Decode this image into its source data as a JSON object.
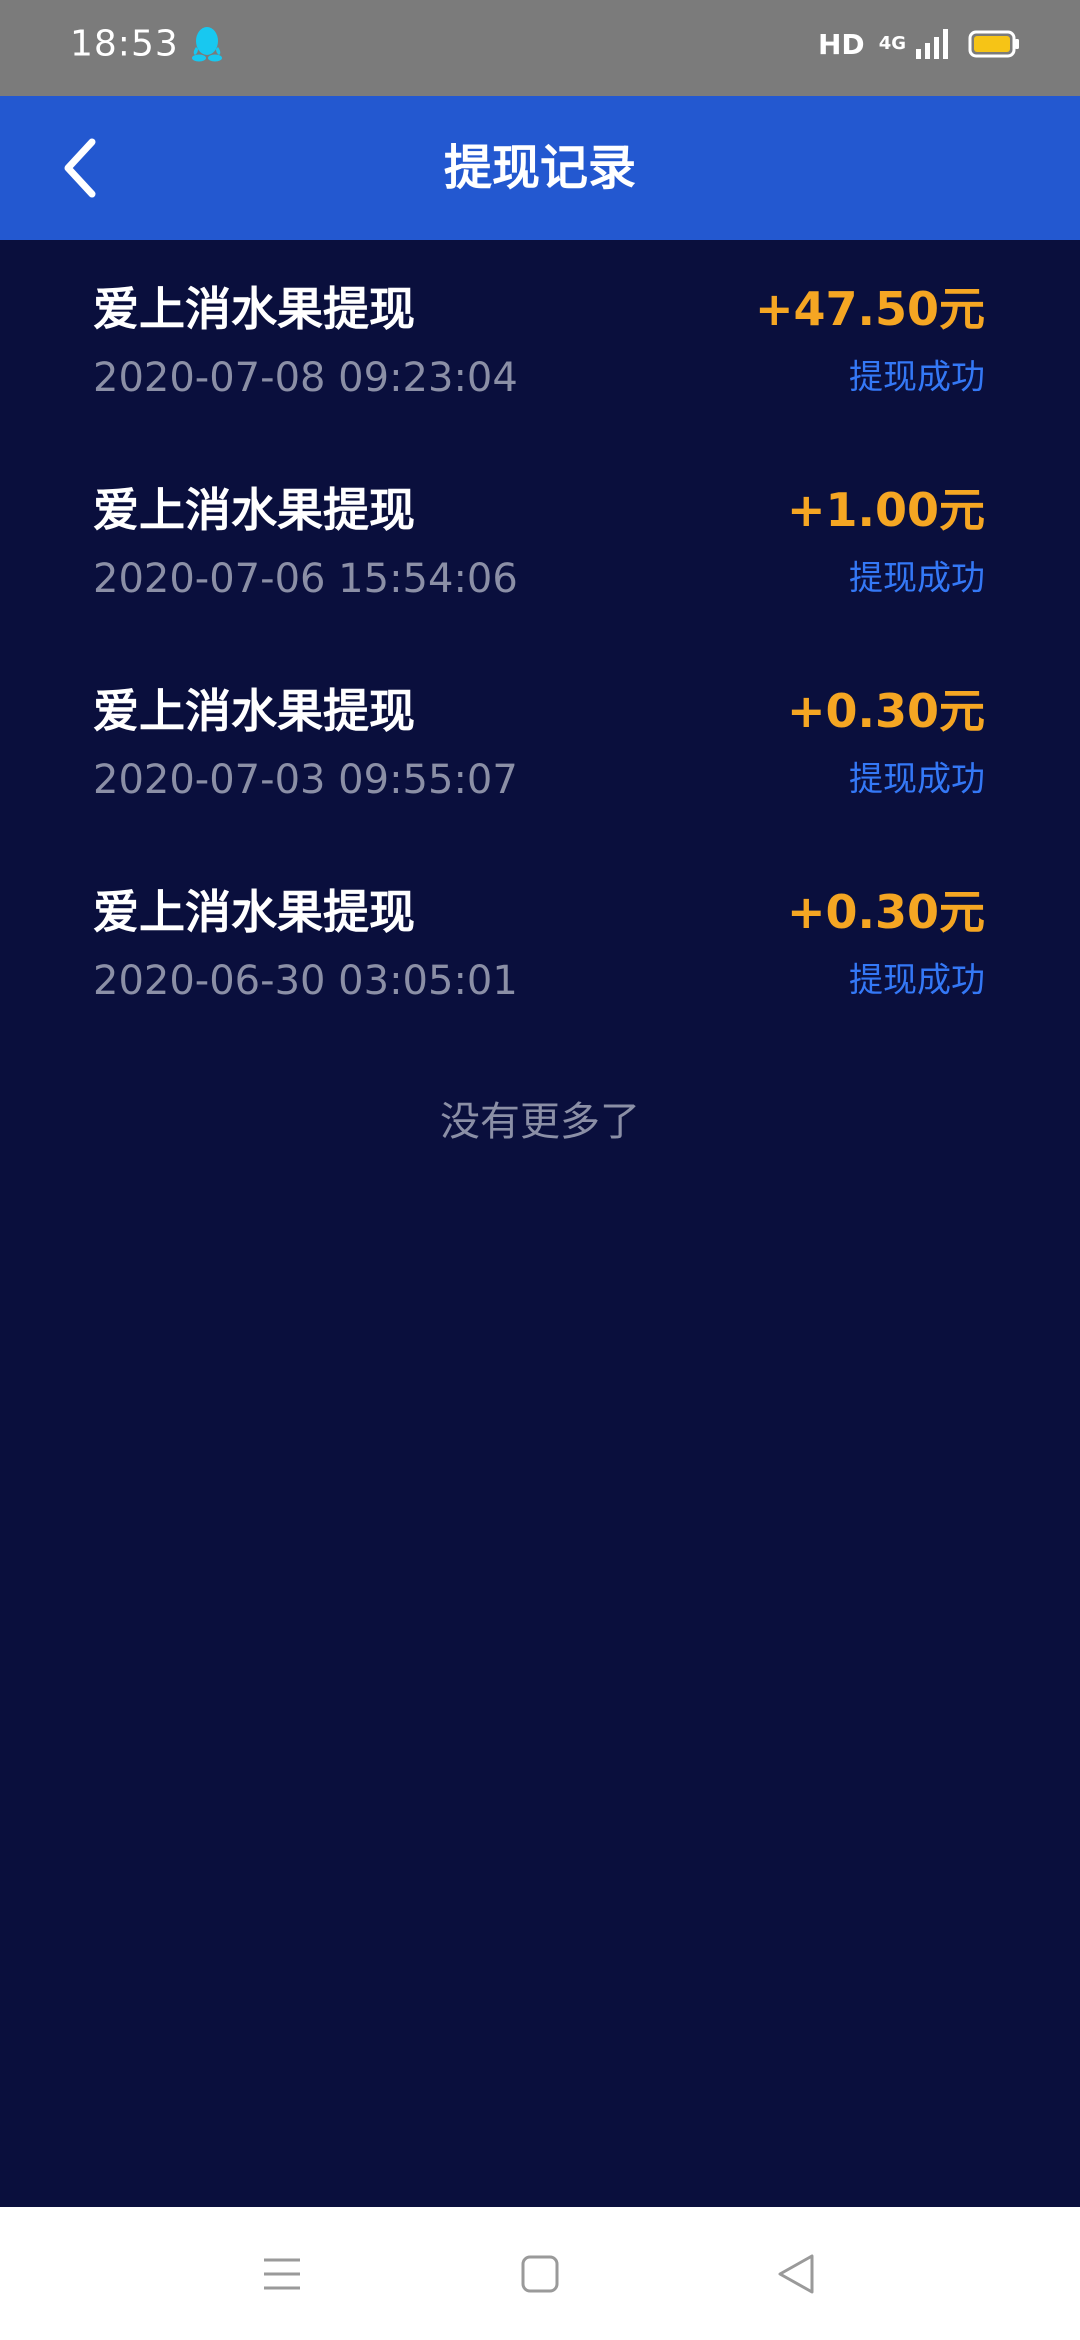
{
  "status_bar": {
    "time": "18:53",
    "hd_label": "HD",
    "network_label": "4G",
    "battery_color": "#f6c416"
  },
  "header": {
    "title": "提现记录",
    "background_color": "#2358d0"
  },
  "records": [
    {
      "title": "爱上消水果提现",
      "time": "2020-07-08 09:23:04",
      "amount": "+47.50元",
      "status": "提现成功"
    },
    {
      "title": "爱上消水果提现",
      "time": "2020-07-06 15:54:06",
      "amount": "+1.00元",
      "status": "提现成功"
    },
    {
      "title": "爱上消水果提现",
      "time": "2020-07-03 09:55:07",
      "amount": "+0.30元",
      "status": "提现成功"
    },
    {
      "title": "爱上消水果提现",
      "time": "2020-06-30 03:05:01",
      "amount": "+0.30元",
      "status": "提现成功"
    }
  ],
  "list_footer": "没有更多了",
  "colors": {
    "page_background": "#0a0f3d",
    "amount": "#f5a623",
    "status": "#3478f6",
    "secondary_text": "#8b8fa6"
  },
  "icons": {
    "status_app": "qq-penguin-icon",
    "back": "chevron-left-icon",
    "nav_menu": "menu-icon",
    "nav_home": "square-home-icon",
    "nav_back": "triangle-back-icon"
  }
}
